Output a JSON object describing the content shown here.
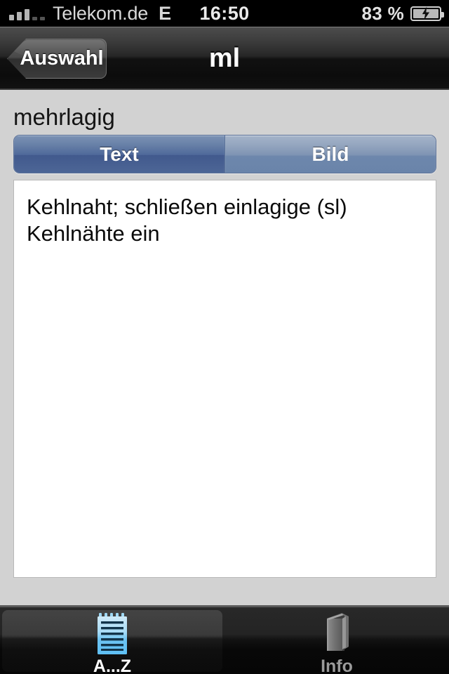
{
  "statusbar": {
    "carrier": "Telekom.de",
    "network_type": "E",
    "time": "16:50",
    "battery_percent": "83 %",
    "signal_icon": "signal-bars-icon",
    "battery_icon": "battery-charging-icon"
  },
  "navbar": {
    "back_label": "Auswahl",
    "title": "ml",
    "back_icon": "back-chevron-icon"
  },
  "content": {
    "headword": "mehrlagig",
    "segments": [
      {
        "label": "Text",
        "selected": true
      },
      {
        "label": "Bild",
        "selected": false
      }
    ],
    "panel_text": "Kehlnaht; schließen einlagige (sl) Kehlnähte ein"
  },
  "tabbar": {
    "tabs": [
      {
        "label": "A...Z",
        "icon": "notepad-icon",
        "active": true
      },
      {
        "label": "Info",
        "icon": "book-icon",
        "active": false
      }
    ]
  },
  "colors": {
    "background": "#d2d2d2",
    "panel": "#ffffff",
    "segment_selected": "#4f699a",
    "segment_unselected": "#8199b8",
    "navbar": "#1a1a1a",
    "tabbar": "#121212",
    "accent_icon": "#6fc6f5"
  }
}
